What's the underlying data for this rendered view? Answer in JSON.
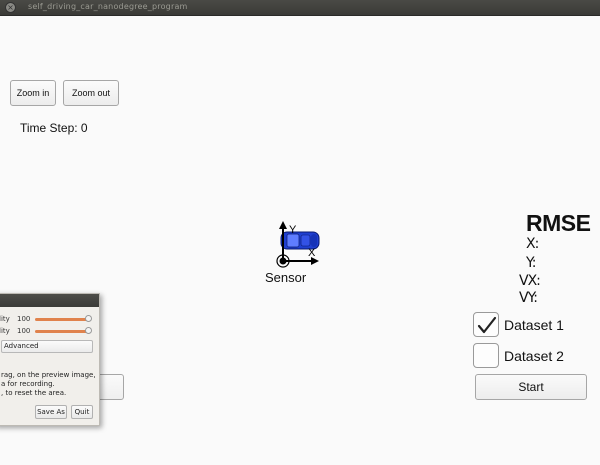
{
  "window": {
    "title": "self_driving_car_nanodegree_program",
    "close_glyph": "×"
  },
  "toolbar": {
    "zoom_in_label": "Zoom in",
    "zoom_out_label": "Zoom out"
  },
  "sim": {
    "time_step_text": "Time Step: 0",
    "sensor_label": "Sensor",
    "axis_x_label": "X",
    "axis_y_label": "Y",
    "car_color": "#1f3fd0"
  },
  "rmse": {
    "title": "RMSE",
    "x_label": "X:",
    "y_label": "Y:",
    "vx_label": "VX:",
    "vy_label": "VY:"
  },
  "datasets": [
    {
      "label": "Dataset 1",
      "checked": true
    },
    {
      "label": "Dataset 2",
      "checked": false
    }
  ],
  "start_label": "Start",
  "recorder_panel": {
    "rows": [
      {
        "label": "lity",
        "value": "100",
        "level": 1.0
      },
      {
        "label": "lity",
        "value": "100",
        "level": 1.0
      }
    ],
    "advanced_label": "Advanced",
    "info_lines": [
      "rag, on the preview image,",
      "a for recording.",
      ", to reset the area."
    ],
    "save_as_label": "Save As",
    "quit_label": "Quit"
  },
  "colors": {
    "accent_slider": "#e0824c",
    "titlebar": "#3c3c3a"
  }
}
